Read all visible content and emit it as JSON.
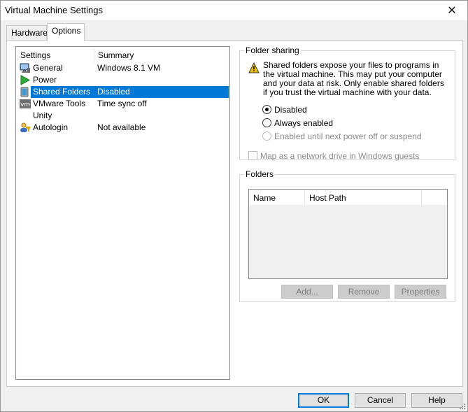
{
  "window": {
    "title": "Virtual Machine Settings",
    "close_glyph": "✕"
  },
  "tabs": [
    {
      "label": "Hardware",
      "active": false
    },
    {
      "label": "Options",
      "active": true
    }
  ],
  "settings": {
    "headers": {
      "settings": "Settings",
      "summary": "Summary"
    },
    "rows": [
      {
        "name": "General",
        "summary": "Windows 8.1 VM",
        "icon": "monitor-icon"
      },
      {
        "name": "Power",
        "summary": "",
        "icon": "play-icon"
      },
      {
        "name": "Shared Folders",
        "summary": "Disabled",
        "icon": "shared-folder-icon",
        "selected": true
      },
      {
        "name": "VMware Tools",
        "summary": "Time sync off",
        "icon": "vmware-icon"
      },
      {
        "name": "Unity",
        "summary": "",
        "icon": "unity-icon"
      },
      {
        "name": "Autologin",
        "summary": "Not available",
        "icon": "users-icon"
      }
    ]
  },
  "folder_sharing": {
    "title": "Folder sharing",
    "warning": "Shared folders expose your files to programs in the virtual machine. This may put your computer and your data at risk. Only enable shared folders if you trust the virtual machine with your data.",
    "options": [
      {
        "label": "Disabled",
        "checked": true,
        "enabled": true
      },
      {
        "label": "Always enabled",
        "checked": false,
        "enabled": true
      },
      {
        "label": "Enabled until next power off or suspend",
        "checked": false,
        "enabled": false
      }
    ],
    "map_drive_label": "Map as a network drive in Windows guests"
  },
  "folders": {
    "title": "Folders",
    "headers": {
      "name": "Name",
      "host_path": "Host Path"
    },
    "buttons": {
      "add": "Add...",
      "remove": "Remove",
      "properties": "Properties"
    }
  },
  "footer": {
    "ok": "OK",
    "cancel": "Cancel",
    "help": "Help"
  },
  "colors": {
    "selection": "#0078d7",
    "warning": "#f2c200"
  }
}
